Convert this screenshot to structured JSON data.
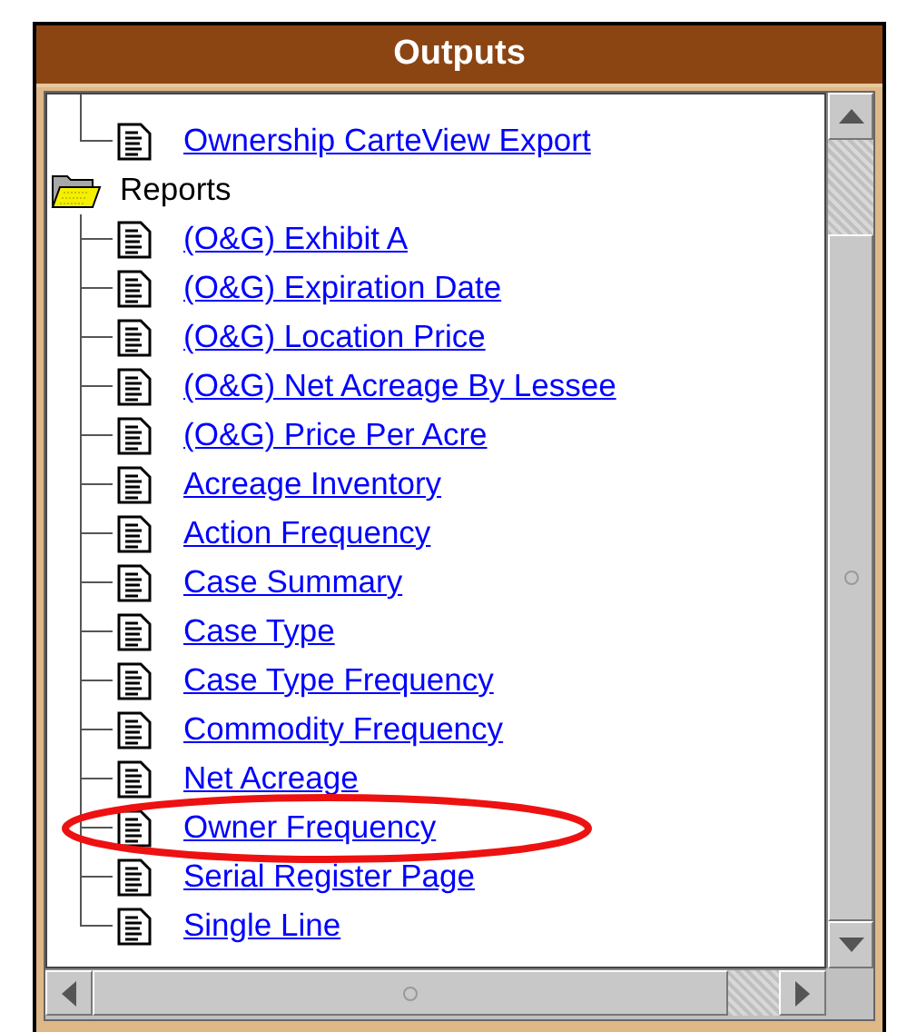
{
  "window": {
    "title": "Outputs"
  },
  "continued_items": [
    {
      "label": "Ownership CarteView Export",
      "circled": false
    }
  ],
  "folders": [
    {
      "label": "Reports",
      "items": [
        {
          "label": "(O&G) Exhibit A",
          "circled": false
        },
        {
          "label": "(O&G) Expiration Date",
          "circled": false
        },
        {
          "label": "(O&G) Location Price",
          "circled": false
        },
        {
          "label": "(O&G) Net Acreage By Lessee",
          "circled": false
        },
        {
          "label": "(O&G) Price Per Acre",
          "circled": false
        },
        {
          "label": "Acreage Inventory",
          "circled": false
        },
        {
          "label": "Action Frequency",
          "circled": false
        },
        {
          "label": "Case Summary",
          "circled": false
        },
        {
          "label": "Case Type",
          "circled": false
        },
        {
          "label": "Case Type Frequency",
          "circled": false
        },
        {
          "label": "Commodity Frequency",
          "circled": false
        },
        {
          "label": "Net Acreage",
          "circled": false
        },
        {
          "label": "Owner Frequency",
          "circled": true
        },
        {
          "label": "Serial Register Page",
          "circled": false
        },
        {
          "label": "Single Line",
          "circled": false
        }
      ]
    }
  ]
}
